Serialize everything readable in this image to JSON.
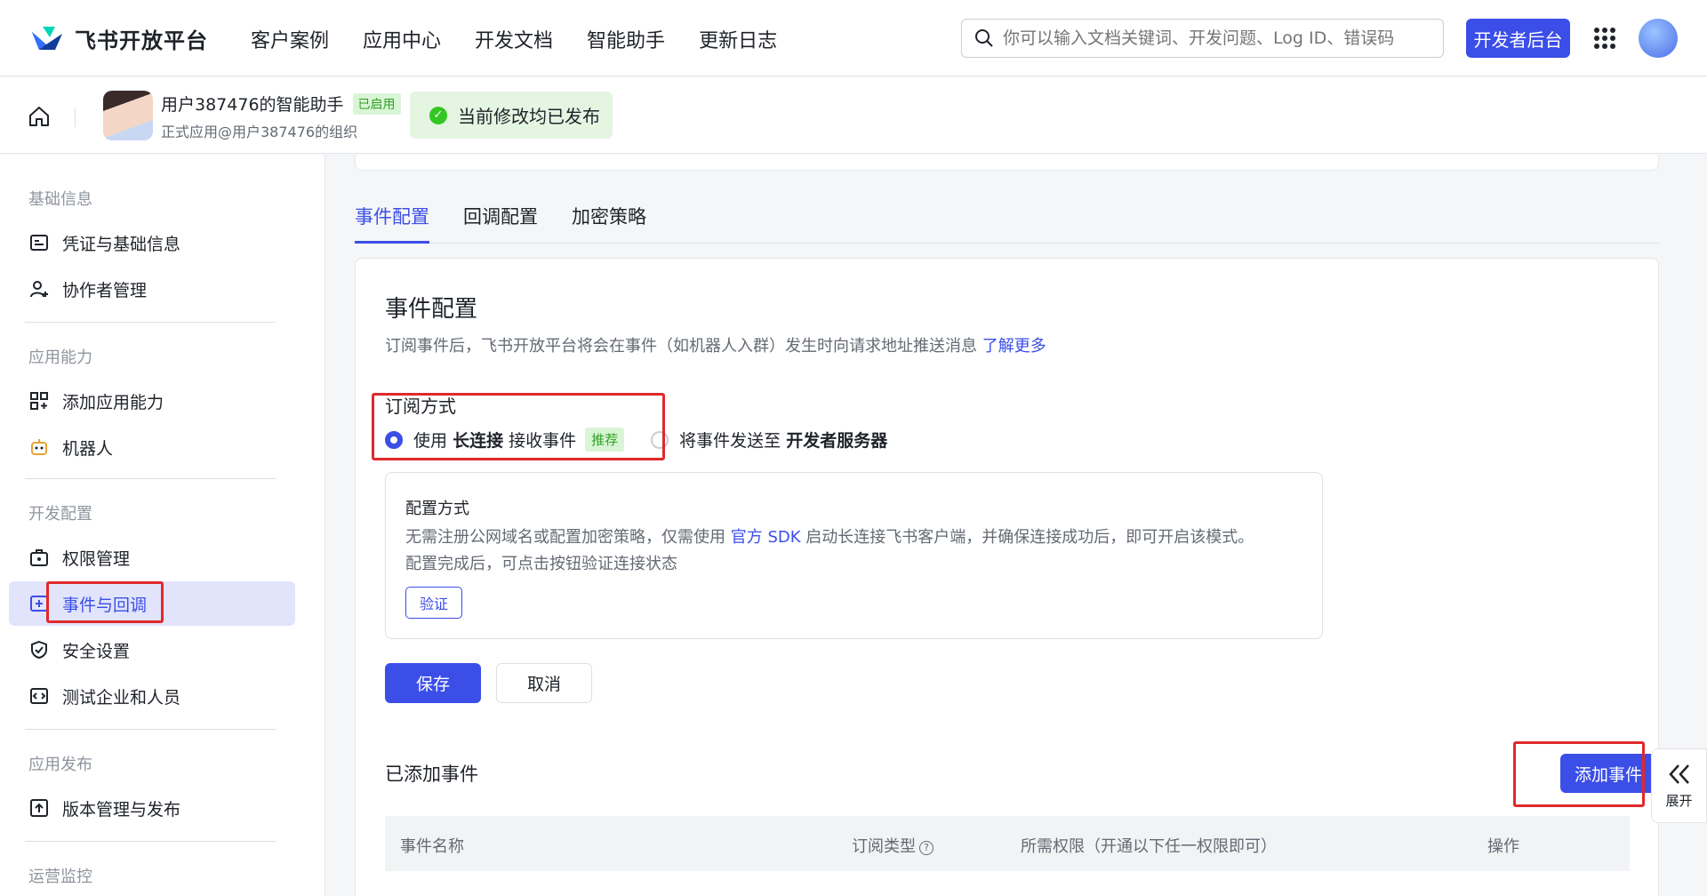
{
  "header": {
    "brand": "飞书开放平台",
    "nav": [
      "客户案例",
      "应用中心",
      "开发文档",
      "智能助手",
      "更新日志"
    ],
    "search_placeholder": "你可以输入文档关键词、开发问题、Log ID、错误码",
    "dev_console": "开发者后台"
  },
  "app": {
    "name": "用户387476的智能助手",
    "status": "已启用",
    "org": "正式应用@用户387476的组织",
    "publish_notice": "当前修改均已发布"
  },
  "sidebar": {
    "sections": [
      {
        "title": "基础信息",
        "items": [
          {
            "label": "凭证与基础信息",
            "icon": "id-card-icon"
          },
          {
            "label": "协作者管理",
            "icon": "user-add-icon"
          }
        ]
      },
      {
        "title": "应用能力",
        "items": [
          {
            "label": "添加应用能力",
            "icon": "apps-add-icon"
          },
          {
            "label": "机器人",
            "icon": "robot-icon"
          }
        ]
      },
      {
        "title": "开发配置",
        "items": [
          {
            "label": "权限管理",
            "icon": "briefcase-lock-icon"
          },
          {
            "label": "事件与回调",
            "icon": "event-icon"
          },
          {
            "label": "安全设置",
            "icon": "shield-icon"
          },
          {
            "label": "测试企业和人员",
            "icon": "code-box-icon"
          }
        ]
      },
      {
        "title": "应用发布",
        "items": [
          {
            "label": "版本管理与发布",
            "icon": "upload-icon"
          }
        ]
      },
      {
        "title": "运营监控",
        "items": []
      }
    ],
    "active": "事件与回调"
  },
  "tabs": [
    "事件配置",
    "回调配置",
    "加密策略"
  ],
  "event_config": {
    "title": "事件配置",
    "desc": "订阅事件后，飞书开放平台将会在事件（如机器人入群）发生时向请求地址推送消息",
    "learn_more": "了解更多",
    "subscribe_label": "订阅方式",
    "option1_pre": "使用",
    "option1_bold": "长连接",
    "option1_post": "接收事件",
    "option1_tag": "推荐",
    "option2_pre": "将事件发送至",
    "option2_bold": "开发者服务器",
    "config_title": "配置方式",
    "config_text_1": "无需注册公网域名或配置加密策略，仅需使用",
    "config_link": "官方 SDK",
    "config_text_2": "启动长连接飞书客户端，并确保连接成功后，即可开启该模式。",
    "config_text_3": "配置完成后，可点击按钮验证连接状态",
    "verify": "验证",
    "save": "保存",
    "cancel": "取消"
  },
  "added_events": {
    "title": "已添加事件",
    "add_button": "添加事件",
    "columns": [
      "事件名称",
      "订阅类型",
      "所需权限（开通以下任一权限即可）",
      "操作"
    ],
    "subscribe_type_help": "?"
  },
  "expand": {
    "label": "展开"
  },
  "colors": {
    "primary": "#3b4ee8",
    "success": "#34c724",
    "highlight": "#e0292a"
  }
}
